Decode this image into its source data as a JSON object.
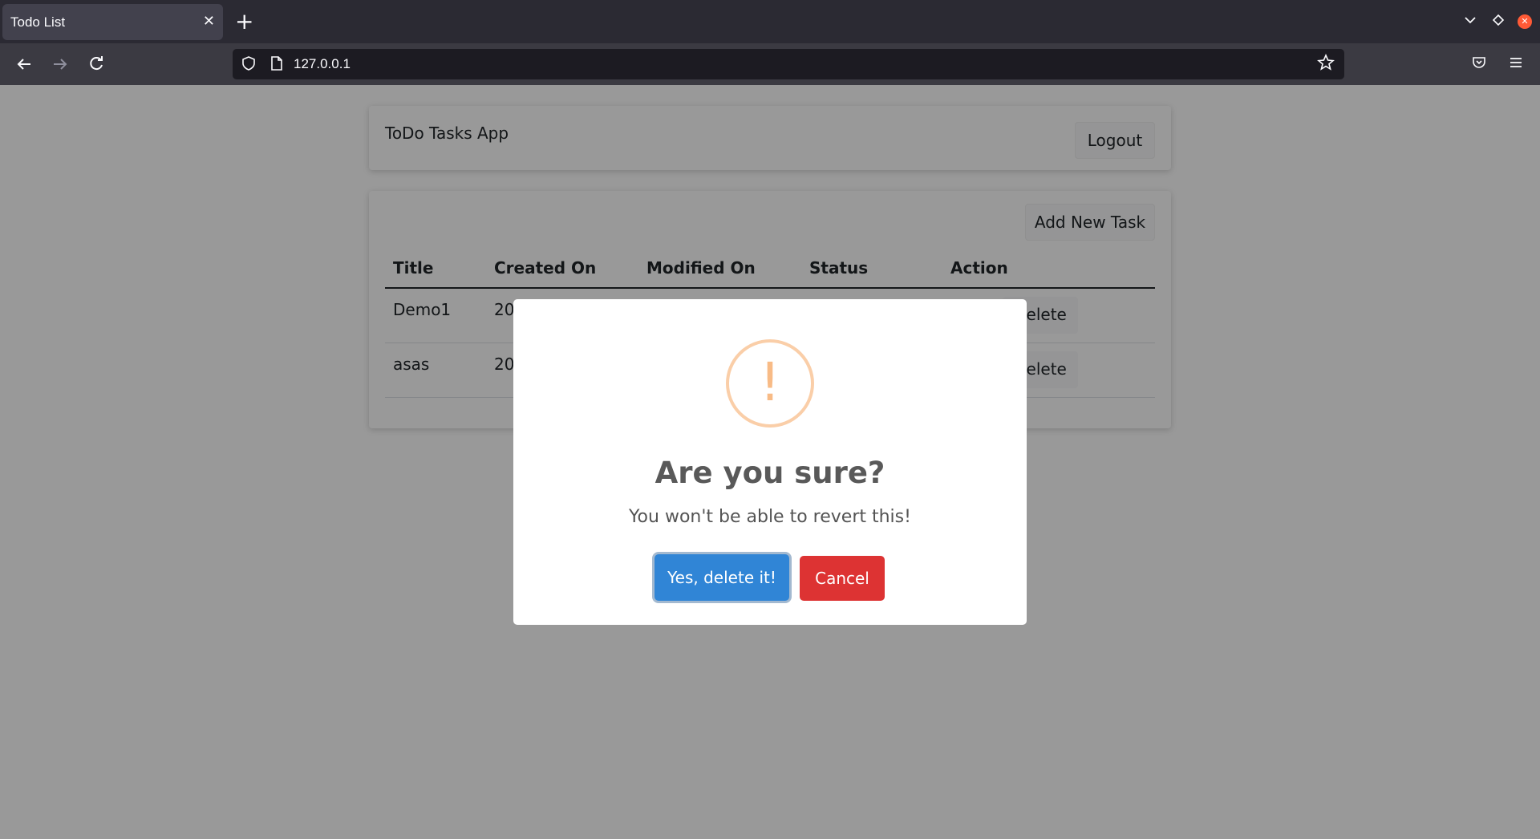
{
  "browser": {
    "tab_title": "Todo List",
    "tab_close": "✕",
    "new_tab": "+",
    "url": "127.0.0.1",
    "icons": [
      "back-arrow-icon",
      "forward-arrow-icon",
      "reload-icon",
      "shield-icon",
      "page-icon",
      "star-icon",
      "pocket-icon",
      "menu-icon",
      "tab-list-icon"
    ]
  },
  "header": {
    "app_title": "ToDo Tasks App",
    "logout_label": "Logout"
  },
  "tasks": {
    "add_label": "Add New Task",
    "columns": [
      "Title",
      "Created On",
      "Modified On",
      "Status",
      "Action"
    ],
    "rows": [
      {
        "title": "Demo1",
        "created": "20",
        "delete_label": "Delete"
      },
      {
        "title": "asas",
        "created": "20",
        "delete_label": "Delete"
      }
    ]
  },
  "dialog": {
    "icon": "!",
    "title": "Are you sure?",
    "text": "You won't be able to revert this!",
    "confirm_label": "Yes, delete it!",
    "cancel_label": "Cancel",
    "colors": {
      "confirm": "#3085d6",
      "cancel": "#dd3333",
      "warning": "#f8bb86"
    }
  }
}
